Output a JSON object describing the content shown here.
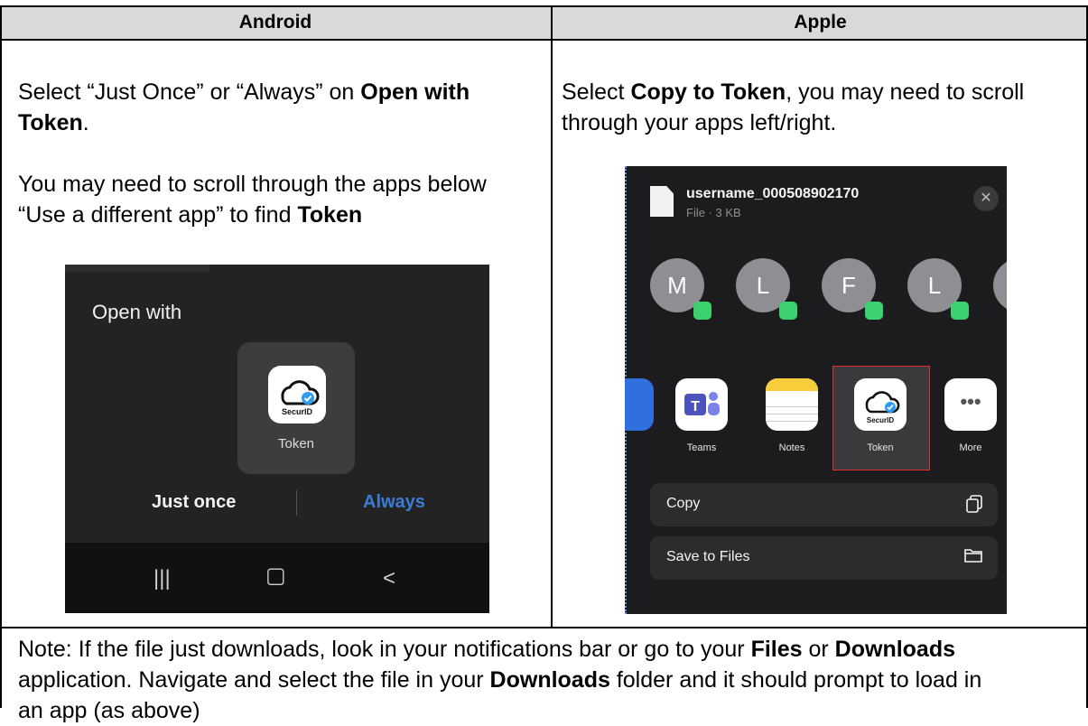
{
  "headers": {
    "android": "Android",
    "apple": "Apple"
  },
  "android": {
    "instruction_1a": "Select “Just Once” or “Always” on ",
    "instruction_1b": "Open with",
    "instruction_1c": "Token",
    "instruction_1d": ".",
    "instruction_2a": "You may need to scroll through the apps below",
    "instruction_2b": "“Use a different app” to find ",
    "instruction_2c": "Token",
    "screen": {
      "title": "Open with",
      "app_logo": "SecurID",
      "app_label": "Token",
      "just_once": "Just once",
      "always": "Always",
      "nav_recent": "|||",
      "nav_home": "▢",
      "nav_back": "<"
    }
  },
  "apple": {
    "instruction_a": "Select ",
    "instruction_b": "Copy to Token",
    "instruction_c": ", you may need to scroll",
    "instruction_d": "through your apps left/right.",
    "screen": {
      "file_name": "username_000508902170",
      "file_meta": "File · 3 KB",
      "close": "✕",
      "avatars": [
        "M",
        "L",
        "F",
        "L"
      ],
      "apps": [
        {
          "label": "Teams"
        },
        {
          "label": "Notes"
        },
        {
          "label": "Token",
          "logo": "SecurID"
        },
        {
          "label": "More"
        }
      ],
      "actions": [
        {
          "label": "Copy",
          "icon": "copy-icon"
        },
        {
          "label": "Save to Files",
          "icon": "folder-icon"
        }
      ]
    }
  },
  "note": {
    "l1a": "Note: If the file just downloads, look in your notifications bar or go to your ",
    "l1b": "Files",
    "l1c": " or ",
    "l1d": "Downloads",
    "l2a": "application.  Navigate and select the file in your ",
    "l2b": "Downloads",
    "l2c": " folder and it should prompt to load in",
    "l3": "an app (as above)"
  },
  "colors": {
    "header_bg": "#d9d9d9",
    "accent_blue": "#3a7cd8",
    "highlight_red": "#e03030"
  }
}
